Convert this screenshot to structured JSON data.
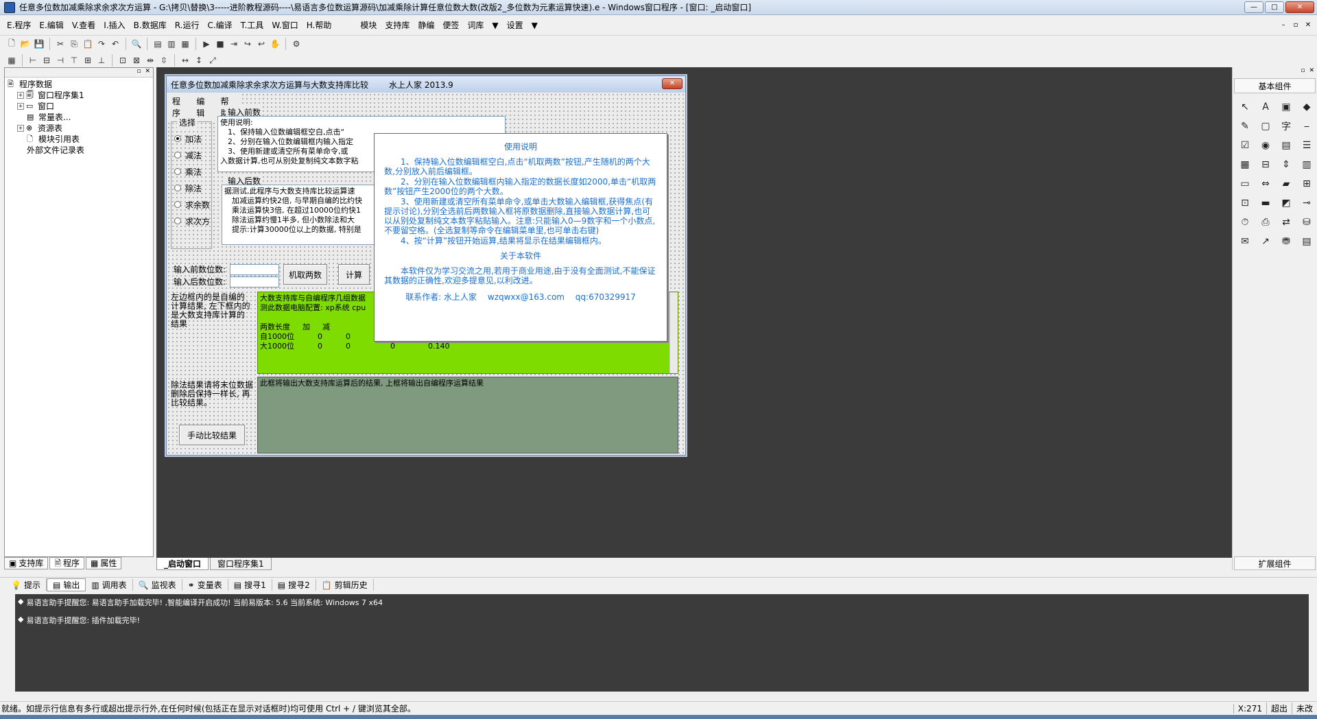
{
  "window": {
    "title": "任意多位数加减乘除求余求次方运算 - G:\\拷贝\\替换\\3-----进阶教程源码----\\易语言多位数运算源码\\加减乘除计算任意位数大数(改版2_多位数为元素运算快速).e - Windows窗口程序 - [窗口: _启动窗口]",
    "buttons": [
      "—",
      "□",
      "✕"
    ]
  },
  "menu": {
    "items": [
      {
        "label": "E.程序"
      },
      {
        "label": "E.编辑"
      },
      {
        "label": "V.查看"
      },
      {
        "label": "I.插入"
      },
      {
        "label": "B.数据库"
      },
      {
        "label": "R.运行"
      },
      {
        "label": "C.编译"
      },
      {
        "label": "T.工具"
      },
      {
        "label": "W.窗口"
      },
      {
        "label": "H.帮助"
      }
    ],
    "extra": [
      "模块",
      "支持库",
      "静编",
      "便签",
      "词库",
      "设置"
    ]
  },
  "tree": {
    "root": "程序数据",
    "items": [
      {
        "label": "窗口程序集1"
      },
      {
        "label": "窗口"
      },
      {
        "label": "常量表..."
      },
      {
        "label": "资源表"
      },
      {
        "label": "模块引用表"
      },
      {
        "label": "外部文件记录表"
      }
    ]
  },
  "left_tabs": [
    "支持库",
    "程序",
    "属性"
  ],
  "doc_tabs": [
    "_启动窗口",
    "窗口程序集1"
  ],
  "form": {
    "title": "任意多位数加减乘除求余求次方运算与大数支持库比较",
    "author": "水上人家 2013.9",
    "menu": [
      "程序",
      "编辑",
      "帮助"
    ],
    "group_select": "选择",
    "ops": [
      "加法",
      "减法",
      "乘法",
      "除法",
      "求余数",
      "求次方"
    ],
    "group_before": "输入前数",
    "group_after": "输入后数",
    "usage_box": "使用说明:\n　1、保持输入位数编辑框空白,点击“\n　2、分别在输入位数编辑框内输入指定\n　3、使用新建或清空所有菜单命令,或\n入数据计算,也可从别处复制纯文本数字粘",
    "after_box": "据测试,此程序与大数支持库比较运算速\n　加减运算约快2倍, 与早期自编的比约快\n　乘法运算快3倍, 在超过10000位约快1\n　除法运算约慢1半多, 但小数除法和大\n　提示:计算30000位以上的数据, 特别是",
    "label_before_digits": "输入前数位数:",
    "label_after_digits": "输入后数位数:",
    "btn_random": "机取两数",
    "btn_calc": "计算",
    "note_left": "左边框内的是自编的计算结果, 左下框内的是大数支持库计算的结果",
    "green_header": "大数支持库与自编程序几组数据",
    "green_sub": "测此数据电脑配置: xp系统 cpu",
    "table_headers": [
      "两数长度",
      "加",
      "减"
    ],
    "table_rows": [
      [
        "自1000位",
        "0",
        "0"
      ],
      [
        "大1000位",
        "0",
        "0",
        "0",
        "0.140"
      ]
    ],
    "note_div": "除法结果请将末位数据删除后保持一样长, 再比较结果。",
    "gray_box": "此框将输出大数支持库运算后的结果, 上框将输出自编程序运算结果",
    "btn_compare": "手动比较结果"
  },
  "usage_dialog": {
    "heading": "使用说明",
    "paras": [
      "1、保持输入位数编辑框空白,点击“机取两数”按钮,产生随机的两个大数,分别放入前后编辑框。",
      "2、分别在输入位数编辑框内输入指定的数据长度如2000,单击“机取两数”按钮产生2000位的两个大数。",
      "3、使用新建或清空所有菜单命令,或单击大数输入编辑框,获得焦点(有提示讨论),分别全选前后两数输入框将原数据删除,直接输入数据计算,也可以从别处复制纯文本数字粘贴输入。注意:只能输入0—9数字和一个小数点,不要留空格。(全选复制等命令在编辑菜单里,也可单击右键)",
      "4、按“计算”按钮开始运算,结果将显示在结果编辑框内。"
    ],
    "about_heading": "关于本软件",
    "about": "本软件仅为学习交流之用,若用于商业用途,由于没有全面测试,不能保证其数据的正确性,欢迎多提意见,以利改进。",
    "contact": "联系作者: 水上人家　 wzqwxx@163.com　 qq:670329917"
  },
  "right_panel": {
    "title": "基本组件",
    "footer": "扩展组件",
    "icons": [
      "pointer-icon",
      "label-icon",
      "picture-icon",
      "shape-icon",
      "edit-icon",
      "frame-icon",
      "text-icon",
      "line-icon",
      "check-icon",
      "radio-icon",
      "combo-icon",
      "list-icon",
      "grid-icon",
      "split-icon",
      "scroll-icon",
      "calendar-icon",
      "rect-icon",
      "hscroll-icon",
      "folder-icon",
      "tree-icon",
      "tab-icon",
      "button-icon",
      "gif-icon",
      "slider-icon",
      "timer-icon",
      "print-icon",
      "sync-icon",
      "db-icon",
      "note-icon",
      "chart-icon",
      "odbc-icon",
      "table-icon"
    ]
  },
  "output": {
    "tabs": [
      "提示",
      "输出",
      "调用表",
      "监视表",
      "变量表",
      "搜寻1",
      "搜寻2",
      "剪辑历史"
    ],
    "lines": [
      "易语言助手提醒您: 易语言助手加载完毕!   ,智能编译开启成功!  当前易版本: 5.6  当前系统: Windows 7 x64",
      "易语言助手提醒您: 插件加载完毕!"
    ]
  },
  "status": {
    "message": "就绪。如提示行信息有多行或超出提示行外,在任何时候(包括正在显示对话框时)均可使用 Ctrl + / 键浏览其全部。",
    "x": "X:271",
    "mode": "超出",
    "state": "未改"
  }
}
